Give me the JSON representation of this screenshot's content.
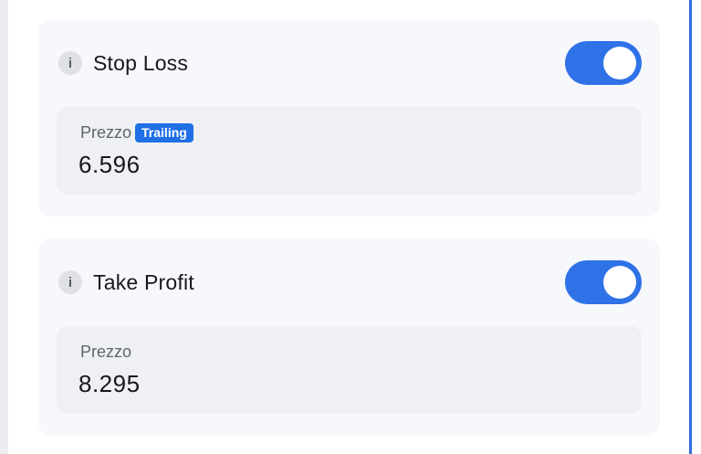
{
  "stop_loss": {
    "title": "Stop Loss",
    "info_icon": "i",
    "toggle_on": true,
    "field_label": "Prezzo",
    "badge": "Trailing",
    "value": "6.596"
  },
  "take_profit": {
    "title": "Take Profit",
    "info_icon": "i",
    "toggle_on": true,
    "field_label": "Prezzo",
    "value": "8.295"
  },
  "colors": {
    "accent": "#2f72e8",
    "badge": "#1f6fe6",
    "card_bg": "#f7f8fc",
    "field_bg": "#eff0f4"
  }
}
